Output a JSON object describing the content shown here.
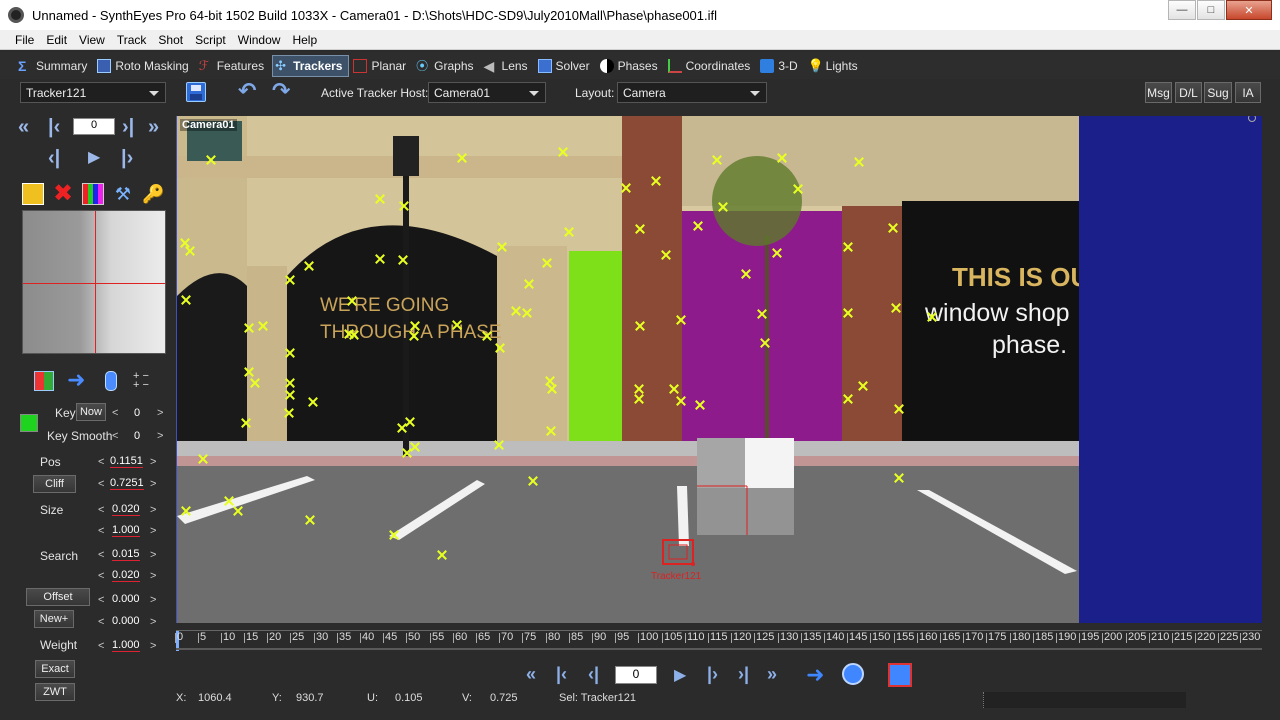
{
  "window": {
    "title": "Unnamed - SynthEyes Pro 64-bit 1502 Build 1033X - Camera01 - D:\\Shots\\HDC-SD9\\July2010Mall\\Phase\\phase001.ifl",
    "minimize": "—",
    "maximize": "□",
    "close": "✕"
  },
  "menu": [
    "File",
    "Edit",
    "View",
    "Track",
    "Shot",
    "Script",
    "Window",
    "Help"
  ],
  "rooms": [
    {
      "label": "Summary",
      "icon": "sigma-icon"
    },
    {
      "label": "Roto Masking",
      "icon": "roto-icon"
    },
    {
      "label": "Features",
      "icon": "features-icon"
    },
    {
      "label": "Trackers",
      "icon": "trackers-icon",
      "active": true
    },
    {
      "label": "Planar",
      "icon": "planar-icon"
    },
    {
      "label": "Graphs",
      "icon": "graphs-icon"
    },
    {
      "label": "Lens",
      "icon": "lens-icon"
    },
    {
      "label": "Solver",
      "icon": "solver-icon"
    },
    {
      "label": "Phases",
      "icon": "phases-icon"
    },
    {
      "label": "Coordinates",
      "icon": "coordinates-icon"
    },
    {
      "label": "3-D",
      "icon": "3d-icon"
    },
    {
      "label": "Lights",
      "icon": "lights-icon"
    }
  ],
  "toolbar": {
    "tracker_select": "Tracker121",
    "active_tracker_host_label": "Active Tracker Host:",
    "active_tracker_host": "Camera01",
    "layout_label": "Layout:",
    "layout": "Camera",
    "msg": "Msg",
    "dl": "D/L",
    "sug": "Sug",
    "ia": "IA"
  },
  "left": {
    "frame": "0",
    "key_label": "Key",
    "now_button": "Now",
    "key_value": "0",
    "key_smooth_label": "Key Smooth",
    "key_smooth_value": "0",
    "pos_label": "Pos",
    "pos_x": "0.1151",
    "pos_y": "0.7251",
    "cliff_button": "Cliff",
    "size_label": "Size",
    "size_w": "0.020",
    "size_h": "1.000",
    "search_label": "Search",
    "search_w": "0.015",
    "search_h": "0.020",
    "offset_button": "Offset",
    "offset_x": "0.000",
    "new_button": "New+",
    "offset_y": "0.000",
    "weight_label": "Weight",
    "weight": "1.000",
    "exact_button": "Exact",
    "zwt_button": "ZWT",
    "plusminus": "+ -\n+ -"
  },
  "viewport": {
    "camera_label": "Camera01",
    "selected_tracker": "Tracker121",
    "sign_lines": [
      "WE'RE GOING",
      "THROUGH A PHASE",
      "THIS IS OU",
      "window shop",
      "phase."
    ]
  },
  "timeline": {
    "ticks": [
      "0",
      "5",
      "10",
      "15",
      "20",
      "25",
      "30",
      "35",
      "40",
      "45",
      "50",
      "55",
      "60",
      "65",
      "70",
      "75",
      "80",
      "85",
      "90",
      "95",
      "100",
      "105",
      "110",
      "115",
      "120",
      "125",
      "130",
      "135",
      "140",
      "145",
      "150",
      "155",
      "160",
      "165",
      "170",
      "175",
      "180",
      "185",
      "190",
      "195",
      "200",
      "205",
      "210",
      "215",
      "220",
      "225",
      "230"
    ]
  },
  "playback": {
    "frame": "0"
  },
  "status": {
    "x_label": "X:",
    "x": "1060.4",
    "y_label": "Y:",
    "y": "930.7",
    "u_label": "U:",
    "u": "0.105",
    "v_label": "V:",
    "v": "0.725",
    "sel": "Sel: Tracker121"
  }
}
